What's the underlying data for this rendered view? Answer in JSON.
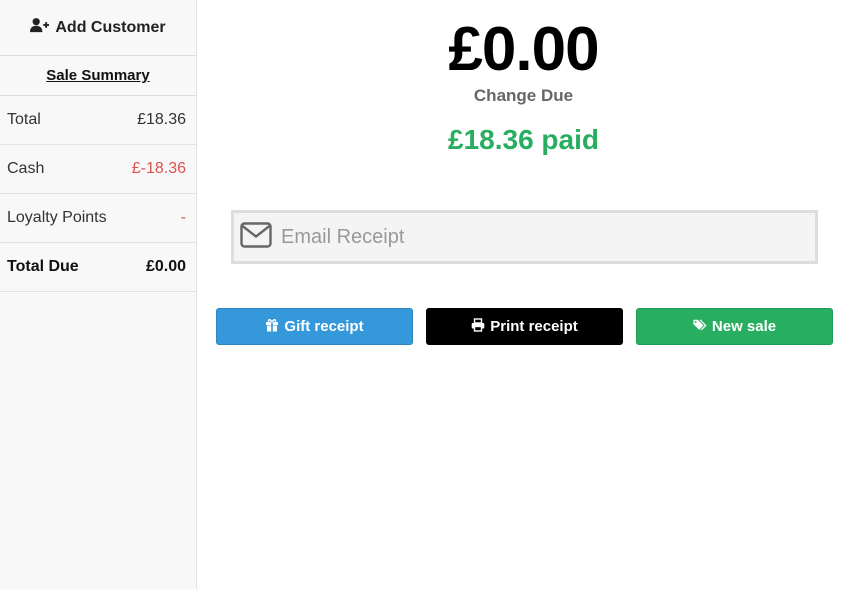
{
  "sidebar": {
    "add_customer_label": "Add Customer",
    "summary_title": "Sale Summary",
    "rows": [
      {
        "label": "Total",
        "value": "£18.36"
      },
      {
        "label": "Cash",
        "value": "£-18.36"
      },
      {
        "label": "Loyalty Points",
        "value": "-"
      },
      {
        "label": "Total Due",
        "value": "£0.00"
      }
    ]
  },
  "main": {
    "change_amount": "£0.00",
    "change_label": "Change Due",
    "paid_text": "£18.36 paid",
    "email_placeholder": "Email Receipt",
    "buttons": {
      "gift": "Gift receipt",
      "print": "Print receipt",
      "new_sale": "New sale"
    }
  },
  "colors": {
    "negative": "#d9534f",
    "paid_green": "#27ae60",
    "gift_blue": "#3498db",
    "print_black": "#000000",
    "new_sale_green": "#27ae60"
  },
  "icons": {
    "add_customer": "user-plus-icon",
    "email": "envelope-icon",
    "gift": "gift-icon",
    "print": "print-icon",
    "new_sale": "tags-icon"
  }
}
